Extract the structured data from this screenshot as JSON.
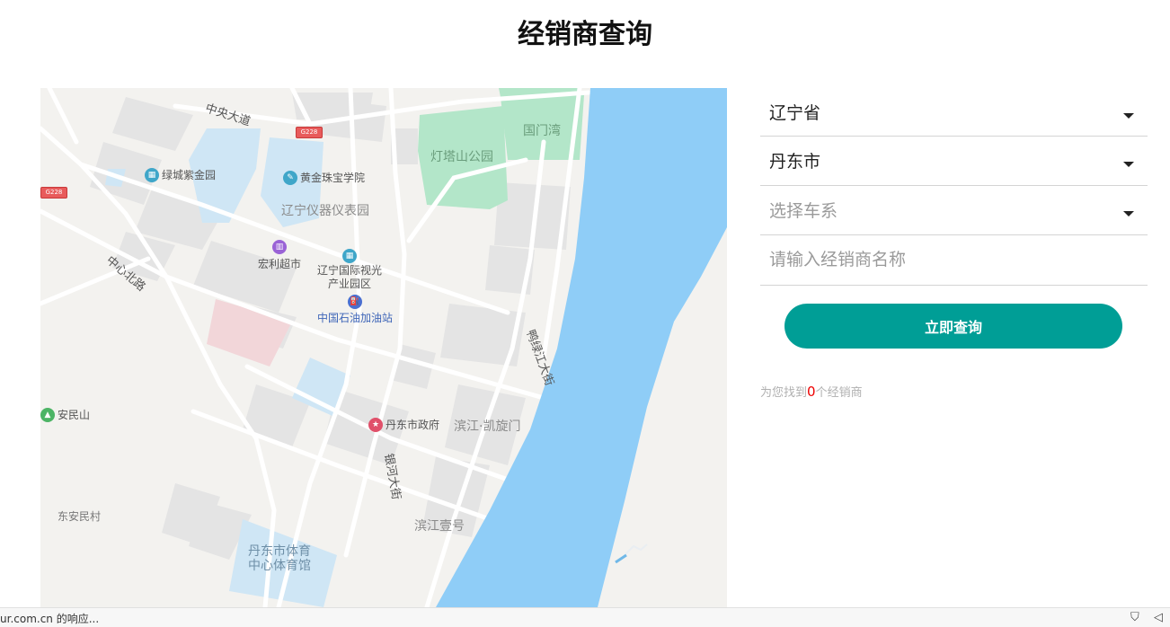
{
  "page": {
    "title": "经销商查询"
  },
  "map": {
    "roads": {
      "central_ave": "中央大道",
      "zhongxin_north": "中心北路",
      "yalu_river_st": "鸭绿江大街",
      "yinhe_ave": "银河大街"
    },
    "route_shields": [
      "G228",
      "G228"
    ],
    "pois": {
      "lvcheng": "绿城紫金园",
      "huangjin": "黄金珠宝学院",
      "liaoning_instrument": "辽宁仪器仪表园",
      "hongli": "宏利超市",
      "liaoning_media_line1": "辽宁国际视光",
      "liaoning_media_line2": "产业园区",
      "petrochina": "中国石油加油站",
      "dengta_park": "灯塔山公园",
      "guomenwan": "国门湾",
      "anminshan": "安民山",
      "government": "丹东市政府",
      "kaixuanmen": "滨江·凯旋门",
      "dongan": "东安民村",
      "binjiang_one": "滨江壹号",
      "sports_line1": "丹东市体育",
      "sports_line2": "中心体育馆"
    }
  },
  "form": {
    "province": "辽宁省",
    "city": "丹东市",
    "series_placeholder": "选择车系",
    "dealer_placeholder": "请输入经销商名称",
    "submit_label": "立即查询",
    "result_prefix": "为您找到",
    "result_count": "0",
    "result_suffix": "个经销商"
  },
  "status_bar": {
    "text": "ur.com.cn 的响应..."
  },
  "colors": {
    "accent": "#009e96",
    "river": "#8fcdf7",
    "park": "#b3e6c9",
    "count": "#e00000"
  }
}
